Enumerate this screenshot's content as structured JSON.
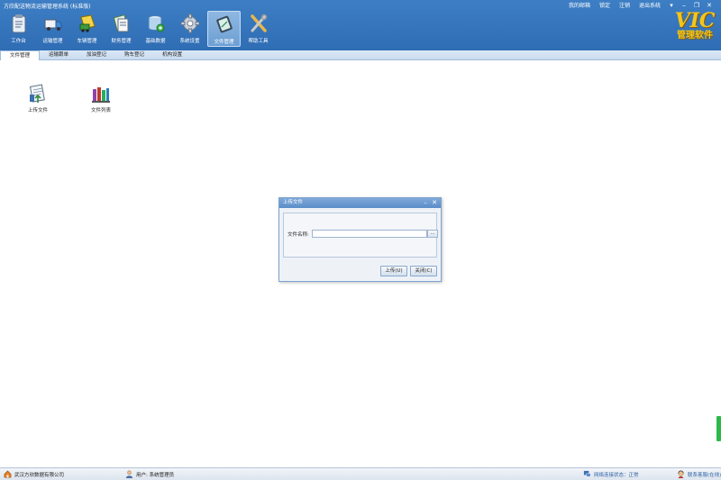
{
  "app": {
    "title": "方欣配送物流运输管理系统 (标准版)"
  },
  "system_links": [
    {
      "name": "sys-link-lock",
      "label": "锁定"
    },
    {
      "name": "sys-link-logout",
      "label": "注销"
    },
    {
      "name": "sys-link-exit",
      "label": "退出系统"
    }
  ],
  "system_links_first": {
    "label": "我的邮箱"
  },
  "window_controls": {
    "dropdown": "▾",
    "minimize": "‒",
    "restore": "❐",
    "close": "✕"
  },
  "toolbar": [
    {
      "key": "workbench",
      "label": "工作台",
      "icon": "clipboard-icon"
    },
    {
      "key": "transport",
      "label": "运输管理",
      "icon": "truck-icon"
    },
    {
      "key": "vehicle",
      "label": "车辆管理",
      "icon": "vehicle-icon"
    },
    {
      "key": "finance",
      "label": "财务管理",
      "icon": "finance-icon"
    },
    {
      "key": "basedata",
      "label": "基础数据",
      "icon": "database-icon"
    },
    {
      "key": "settings",
      "label": "系统设置",
      "icon": "gear-icon"
    },
    {
      "key": "files",
      "label": "文件管理",
      "icon": "file-manager-icon",
      "active": true
    },
    {
      "key": "tools",
      "label": "帮助工具",
      "icon": "tools-icon"
    }
  ],
  "logo": {
    "top": "VIC",
    "bottom": "管理软件"
  },
  "subtabs": [
    {
      "label": "文件管理",
      "active": true
    },
    {
      "label": "运输跟单"
    },
    {
      "label": "加油登记"
    },
    {
      "label": "购车登记"
    },
    {
      "label": "机构设置"
    }
  ],
  "content_items": [
    {
      "label": "上传文件",
      "icon": "upload-file-icon"
    },
    {
      "label": "文件列表",
      "icon": "file-list-icon"
    }
  ],
  "dialog": {
    "title": "上传文件",
    "minimize": "–",
    "close": "✕",
    "field_label": "文件名称:",
    "field_value": "",
    "browse_label": "...",
    "upload_button": "上传(U)",
    "close_button": "关闭(C)"
  },
  "statusbar": {
    "company": "武汉方欣数据有限公司",
    "user": "用户: 系统管理员",
    "network": "网络连接状态：正常",
    "service": "联系客服(在线)"
  },
  "colors": {
    "header_blue": "#2f6db4",
    "logo_gold": "#f3c61d",
    "scroll_green": "#2fb84a"
  }
}
